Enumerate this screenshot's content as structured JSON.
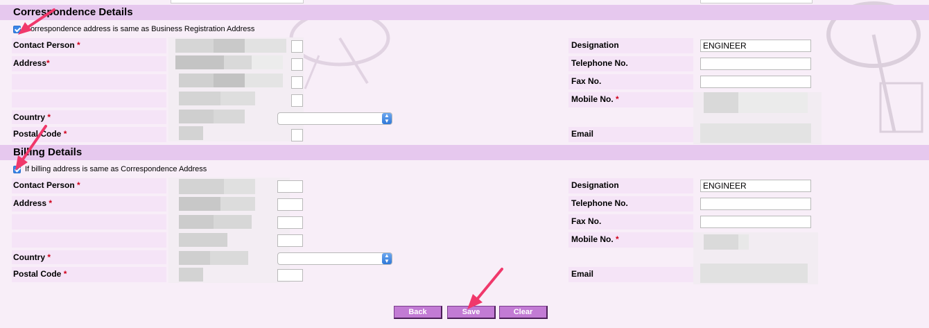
{
  "correspondence": {
    "title": "Correspondence Details",
    "same_as_label": "Correspondence address is same as Business Registration Address",
    "contact_person_label": "Contact Person",
    "address_label": "Address",
    "country_label": "Country",
    "postal_code_label": "Postal Code",
    "designation_label": "Designation",
    "designation_value": "ENGINEER",
    "telephone_label": "Telephone No.",
    "fax_label": "Fax No.",
    "mobile_label": "Mobile No.",
    "email_label": "Email",
    "required_mark": "*"
  },
  "billing": {
    "title": "Billing Details",
    "same_as_label": "If billing address is same as Correspondence Address",
    "contact_person_label": "Contact Person",
    "address_label": "Address",
    "country_label": "Country",
    "postal_code_label": "Postal Code",
    "designation_label": "Designation",
    "designation_value": "ENGINEER",
    "telephone_label": "Telephone No.",
    "fax_label": "Fax No.",
    "mobile_label": "Mobile No.",
    "email_label": "Email",
    "required_mark": "*"
  },
  "actions": {
    "back_label": "Back",
    "save_label": "Save",
    "clear_label": "Clear"
  },
  "colors": {
    "section_header": "#e6c8ee",
    "row_highlight": "#f5e4f7",
    "button": "#c27bd4",
    "annotation_arrow": "#f0386b",
    "checkbox": "#3a86e8"
  }
}
